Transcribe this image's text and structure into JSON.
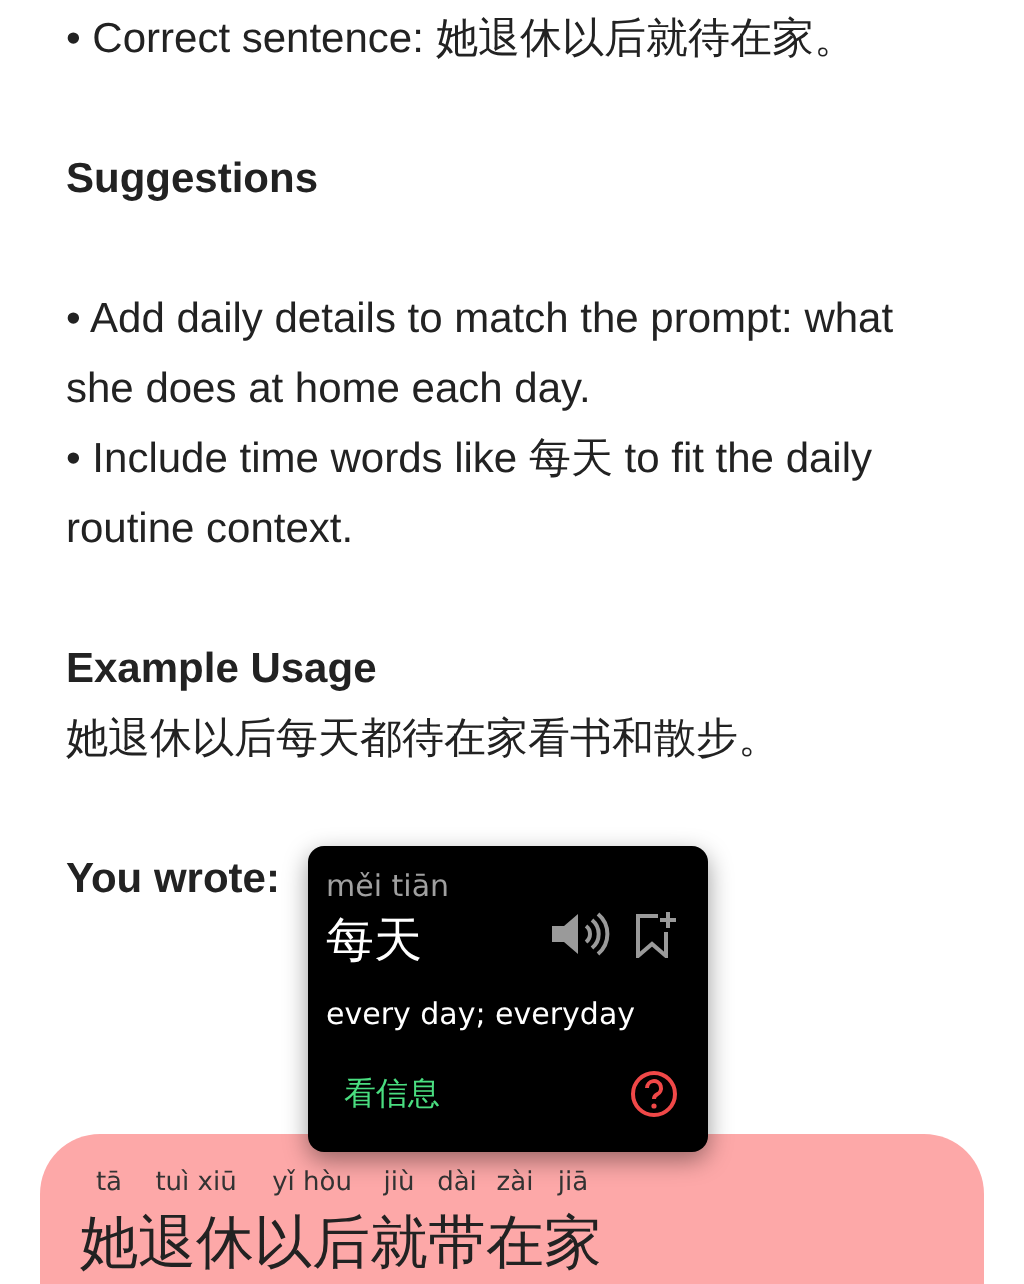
{
  "blocks": [
    {
      "lines": [
        "• Correct sentence: 她退休以后就待在家。"
      ]
    },
    {
      "heading": "Suggestions"
    },
    {
      "lines": [
        "• Add daily details to match the prompt: what she does at home each day.",
        "• Include time words like 每天 to fit the daily routine context."
      ]
    },
    {
      "heading": "Example Usage",
      "lines": [
        "她退休以后每天都待在家看书和散步。"
      ]
    },
    {
      "heading": "You wrote:"
    }
  ],
  "popup": {
    "pinyin": "měi tiān",
    "word": "每天",
    "definition": "every day; everyday",
    "link": "看信息"
  },
  "sentence_card": {
    "words": [
      {
        "pinyin": "tā",
        "hanzi": "她"
      },
      {
        "pinyin": "tuì xiū",
        "hanzi": "退休"
      },
      {
        "pinyin": "yǐ hòu",
        "hanzi": "以后"
      },
      {
        "pinyin": "jiù",
        "hanzi": "就"
      },
      {
        "pinyin": "dài",
        "hanzi": "带"
      },
      {
        "pinyin": "zài",
        "hanzi": "在"
      },
      {
        "pinyin": "jiā",
        "hanzi": "家"
      }
    ]
  }
}
